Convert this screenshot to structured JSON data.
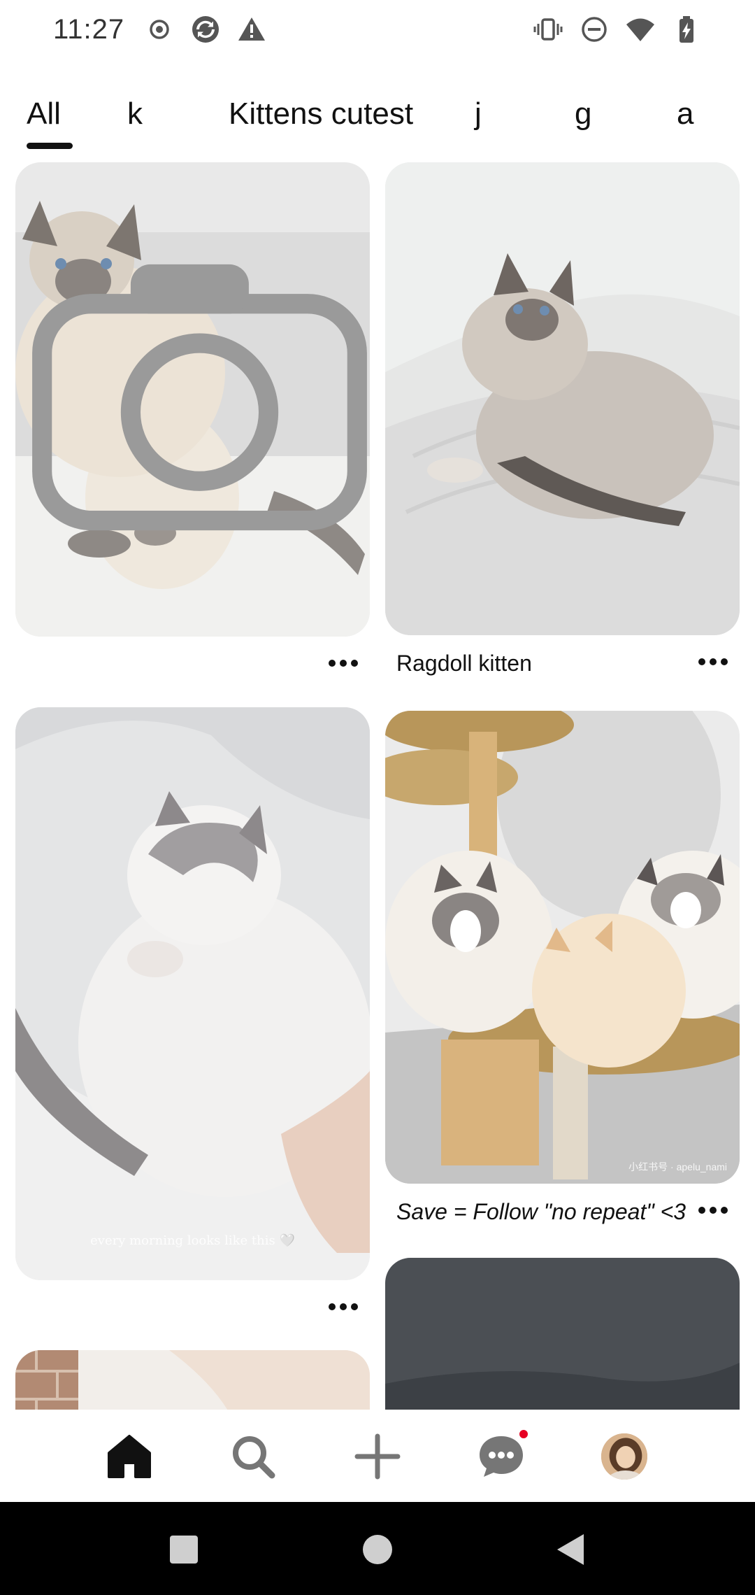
{
  "status_bar": {
    "time": "11:27",
    "left_icons": [
      "record-icon",
      "sync-icon",
      "warning-icon"
    ],
    "right_icons": [
      "vibrate-icon",
      "do-not-disturb-icon",
      "wifi-icon",
      "battery-charging-icon"
    ]
  },
  "tabs": {
    "items": [
      {
        "label": "All",
        "active": true
      },
      {
        "label": "k",
        "active": false
      },
      {
        "label": "Kittens cutest",
        "active": false
      },
      {
        "label": "j",
        "active": false
      },
      {
        "label": "g",
        "active": false
      },
      {
        "label": "a",
        "active": false
      }
    ]
  },
  "feed": {
    "pins": [
      {
        "title": "",
        "image_desc": "siamese-kitten-sitting",
        "has_camera_badge": true
      },
      {
        "title": "Ragdoll kitten",
        "image_desc": "ragdoll-kitten-on-bed"
      },
      {
        "title": "",
        "image_desc": "sleeping-ragdoll-cat",
        "overlay_caption": "every morning looks like this 🤍"
      },
      {
        "title": "Save = Follow \"no repeat\" <3",
        "image_desc": "three-kittens-in-cat-tree",
        "watermark": "小红书号 · apelu_nami"
      },
      {
        "title": "",
        "image_desc": "partial-pin-brick"
      },
      {
        "title": "",
        "image_desc": "partial-pin-dark"
      }
    ],
    "more_icon": "more-horizontal-icon"
  },
  "bottom_nav": {
    "items": [
      {
        "name": "home",
        "icon": "home-icon",
        "active": true
      },
      {
        "name": "search",
        "icon": "search-icon"
      },
      {
        "name": "create",
        "icon": "plus-icon"
      },
      {
        "name": "messages",
        "icon": "chat-bubble-icon",
        "has_notification": true
      },
      {
        "name": "profile",
        "icon": "avatar"
      }
    ]
  },
  "colors": {
    "notification": "#e60023",
    "text": "#111111",
    "system_nav_bg": "#000000"
  }
}
